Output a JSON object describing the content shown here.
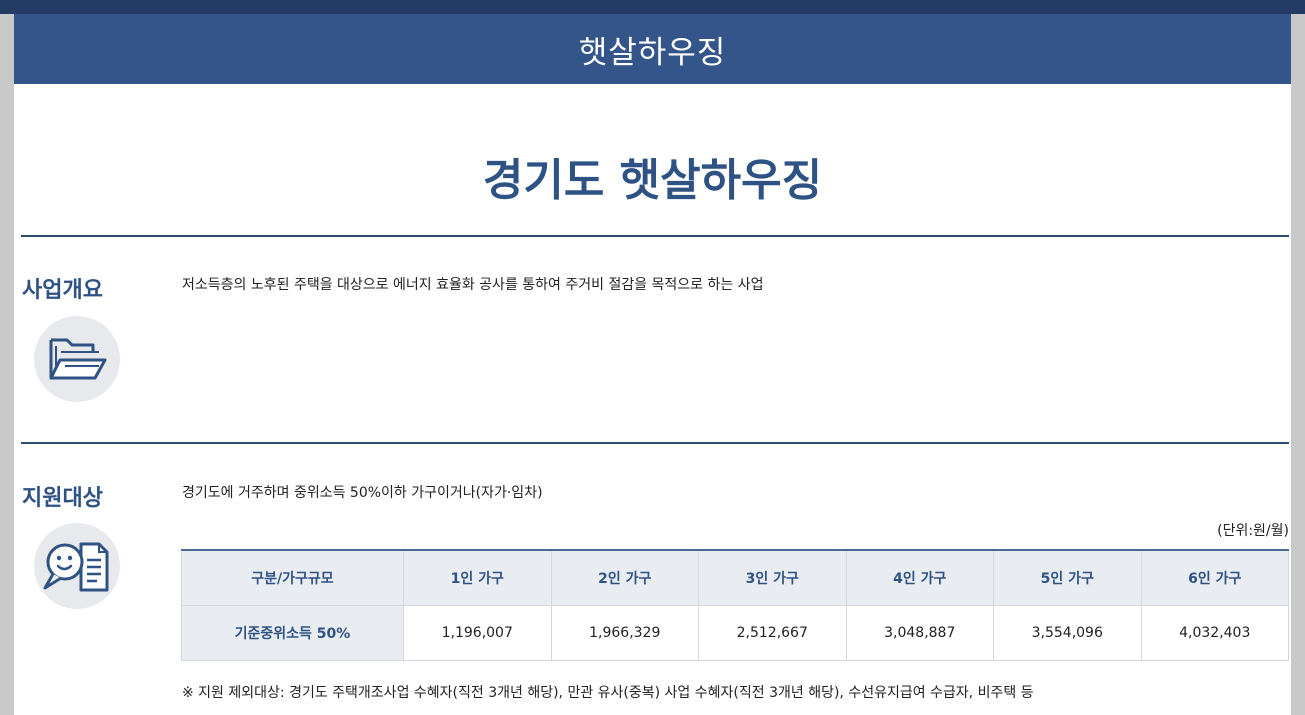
{
  "header": {
    "title": "햇살하우징"
  },
  "main": {
    "title": "경기도 햇살하우징"
  },
  "overview": {
    "title": "사업개요",
    "icon": "folder-icon",
    "text": "저소득층의 노후된 주택을 대상으로 에너지 효율화 공사를 통하여 주거비 절감을 목적으로 하는 사업"
  },
  "eligibility": {
    "title": "지원대상",
    "icon": "person-document-icon",
    "text": "경기도에 거주하며 중위소득 50%이하 가구이거나(자가·임차)",
    "unit": "(단위:원/월)",
    "table": {
      "headers": [
        "구분/가구규모",
        "1인 가구",
        "2인 가구",
        "3인 가구",
        "4인 가구",
        "5인 가구",
        "6인 가구"
      ],
      "row_label": "기준중위소득 50%",
      "values": [
        "1,196,007",
        "1,966,329",
        "2,512,667",
        "3,048,887",
        "3,554,096",
        "4,032,403"
      ]
    },
    "note": "※ 지원 제외대상: 경기도 주택개조사업 수혜자(직전 3개년 해당), 만관 유사(중복) 사업 수혜자(직전 3개년 해당), 수선유지급여 수급자, 비주택 등"
  },
  "colors": {
    "primary": "#2f5285",
    "header_bg": "#34558a",
    "header_dark": "#233b64",
    "table_header_bg": "#e9edf1"
  }
}
